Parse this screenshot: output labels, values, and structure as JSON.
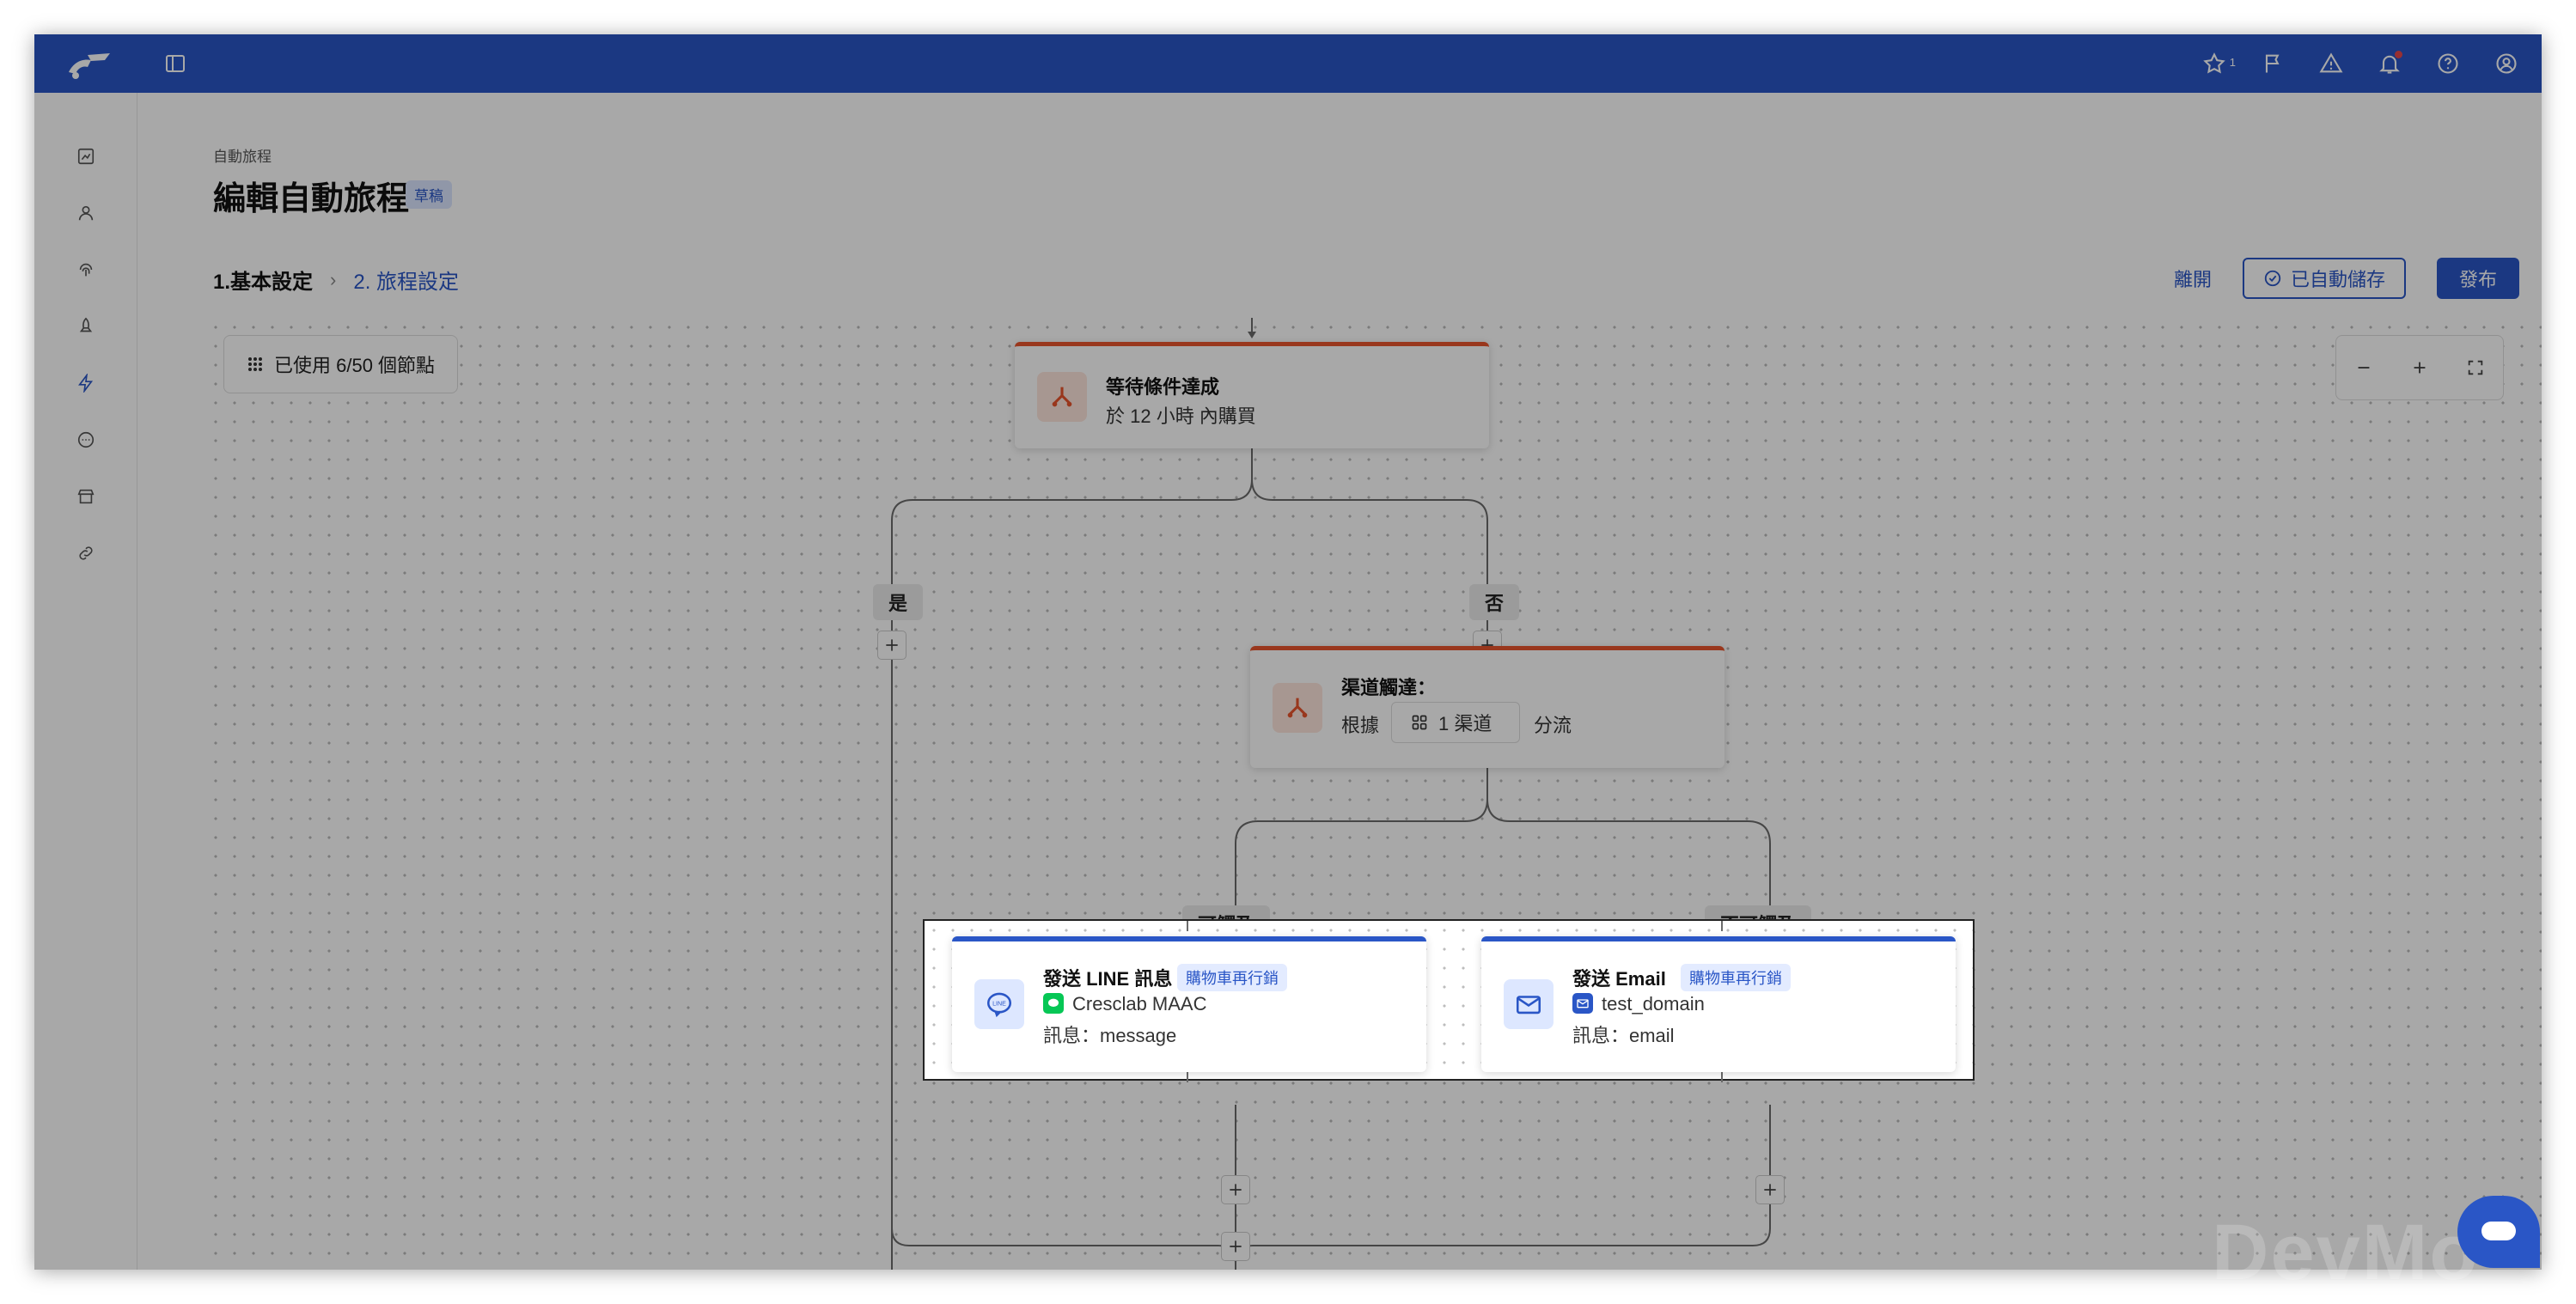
{
  "breadcrumb": "自動旅程",
  "page_title": "編輯自動旅程",
  "status_badge": "草稿",
  "steps": {
    "step1": "1.基本設定",
    "separator": "›",
    "step2": "2. 旅程設定"
  },
  "actions": {
    "leave": "離開",
    "autosave": "已自動儲存",
    "publish": "發布"
  },
  "node_counter": "已使用 6/50 個節點",
  "topbar": {
    "star_count": "1"
  },
  "nodes": {
    "wait": {
      "title": "等待條件達成",
      "subtitle": "於 12 小時 內購買"
    },
    "channel": {
      "title": "渠道觸達：",
      "prefix": "根據",
      "chip": "1 渠道",
      "suffix": "分流"
    },
    "line": {
      "title": "發送 LINE 訊息",
      "tag": "購物車再行銷",
      "account": "Cresclab MAAC",
      "message": "訊息：message"
    },
    "email": {
      "title": "發送 Email",
      "tag": "購物車再行銷",
      "account": "test_domain",
      "message": "訊息：email"
    }
  },
  "branches": {
    "yes": "是",
    "no": "否",
    "reachable": "可觸及",
    "unreachable": "不可觸及"
  },
  "watermark": "DevMo",
  "colors": {
    "primary": "#2a56c6",
    "accent": "#e8542c",
    "overlay": "rgba(0,0,0,0.34)"
  },
  "icons": [
    "logo",
    "sidebar-toggle-icon",
    "star-icon",
    "flag-icon",
    "warning-icon",
    "bell-icon",
    "help-icon",
    "user-icon",
    "chart-icon",
    "person-icon",
    "fingerprint-icon",
    "rocket-icon",
    "lightning-icon",
    "chat-icon",
    "store-icon",
    "link-icon",
    "grid-icon",
    "minus-icon",
    "plus-icon",
    "fullscreen-icon",
    "split-icon",
    "line-icon",
    "mail-icon"
  ]
}
